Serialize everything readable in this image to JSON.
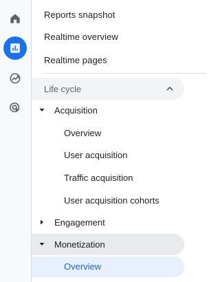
{
  "rail": {
    "items": [
      {
        "icon": "home-icon",
        "active": false
      },
      {
        "icon": "reports-icon",
        "active": true
      },
      {
        "icon": "explore-icon",
        "active": false
      },
      {
        "icon": "advertising-icon",
        "active": false
      }
    ],
    "accent": "#1a73e8"
  },
  "nav": {
    "top_items": [
      {
        "label": "Reports snapshot"
      },
      {
        "label": "Realtime overview"
      },
      {
        "label": "Realtime pages"
      }
    ],
    "section": {
      "label": "Life cycle",
      "expanded": true
    },
    "groups": [
      {
        "label": "Acquisition",
        "expanded": true,
        "children": [
          {
            "label": "Overview"
          },
          {
            "label": "User acquisition"
          },
          {
            "label": "Traffic acquisition"
          },
          {
            "label": "User acquisition cohorts"
          }
        ]
      },
      {
        "label": "Engagement",
        "expanded": false
      },
      {
        "label": "Monetization",
        "expanded": true,
        "children": [
          {
            "label": "Overview",
            "selected": true
          }
        ]
      }
    ]
  },
  "colors": {
    "selected_text": "#1967d2",
    "selected_bg": "#e8f0fe",
    "section_bg": "#f1f3f4",
    "group_highlight_bg": "#e8eaed"
  }
}
